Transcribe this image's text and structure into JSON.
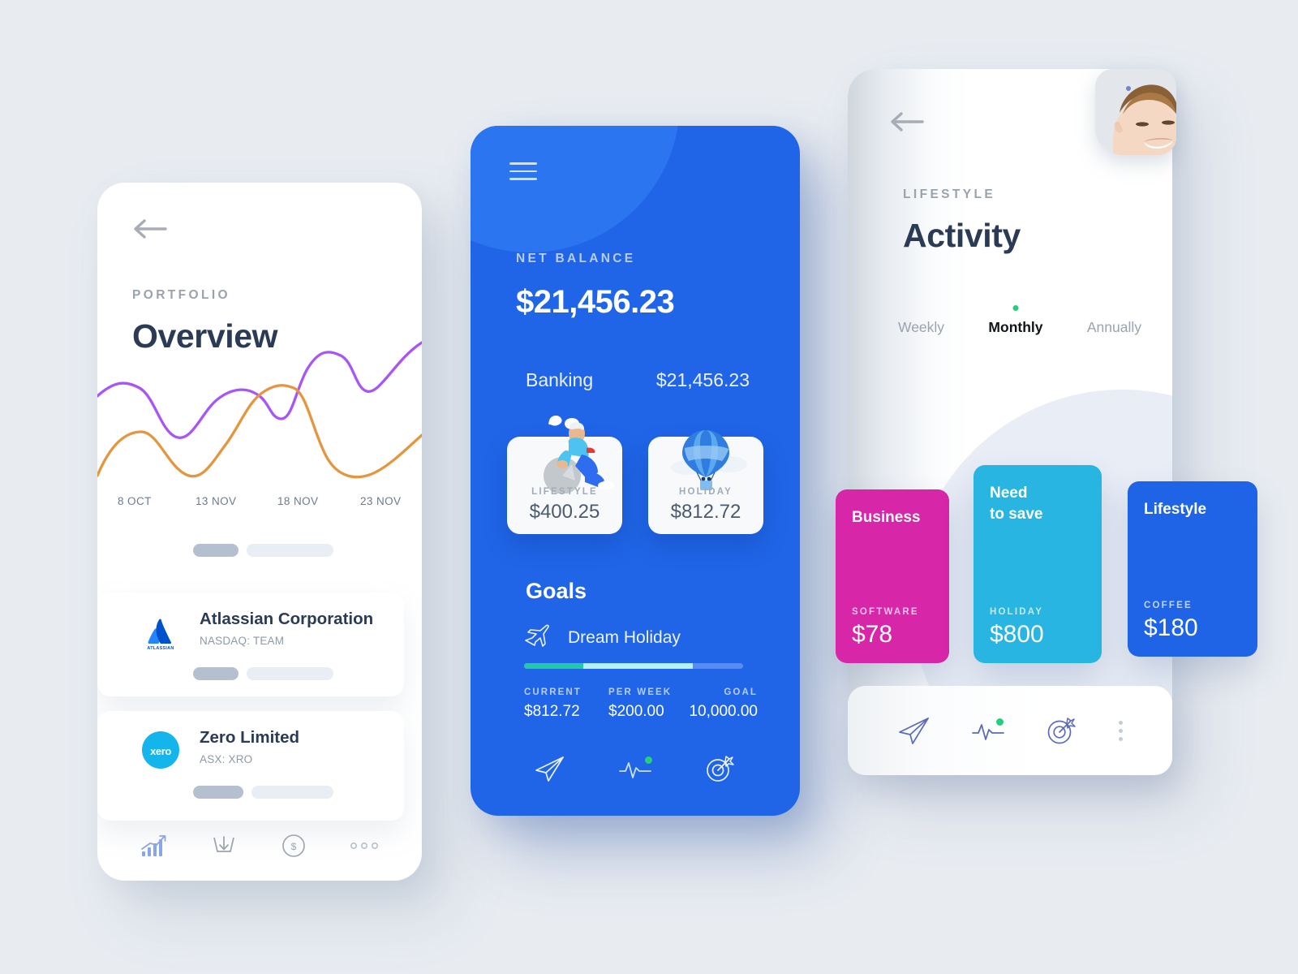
{
  "canvas": {
    "background": "#e8ecf1"
  },
  "phone1": {
    "back_icon": "back-arrow-icon",
    "eyebrow": "PORTFOLIO",
    "title": "Overview",
    "chart": {
      "axis_labels": [
        "8 OCT",
        "13 NOV",
        "18 NOV",
        "23 NOV"
      ],
      "series_colors": [
        "#a855f7",
        "#e4963f"
      ]
    },
    "stocks": [
      {
        "name": "Atlassian Corporation",
        "ticker": "NASDAQ: TEAM",
        "logo": "atlassian-logo"
      },
      {
        "name": "Zero Limited",
        "ticker": "ASX: XRO",
        "logo": "xero-logo"
      }
    ],
    "nav": [
      {
        "icon": "growth-chart-icon",
        "active": true
      },
      {
        "icon": "deposit-icon",
        "active": false
      },
      {
        "icon": "dollar-circle-icon",
        "active": false
      },
      {
        "icon": "more-horizontal-icon",
        "active": false
      }
    ]
  },
  "phone2": {
    "menu_icon": "hamburger-menu-icon",
    "net_balance_label": "NET BALANCE",
    "net_balance_amount": "$21,456.23",
    "account_name": "Banking",
    "account_amount": "$21,456.23",
    "cards": [
      {
        "caption": "LIFESTYLE",
        "value": "$400.25",
        "illustration": "person-on-ball-illustration"
      },
      {
        "caption": "HOLIDAY",
        "value": "$812.72",
        "illustration": "hot-air-balloon-illustration"
      }
    ],
    "goals_heading": "Goals",
    "goal": {
      "icon": "paper-plane-travel-icon",
      "name": "Dream Holiday",
      "progress_segment_a_pct": 27,
      "progress_segment_b_pct": 50,
      "columns": [
        {
          "label": "CURRENT",
          "value": "$812.72"
        },
        {
          "label": "PER WEEK",
          "value": "$200.00"
        },
        {
          "label": "GOAL",
          "value": "10,000.00"
        }
      ]
    },
    "nav": [
      {
        "icon": "send-icon",
        "badge": false
      },
      {
        "icon": "pulse-activity-icon",
        "badge": true
      },
      {
        "icon": "target-goal-icon",
        "badge": false
      }
    ]
  },
  "phone3": {
    "back_icon": "back-arrow-icon",
    "avatar": "user-avatar",
    "eyebrow": "LIFESTYLE",
    "title": "Activity",
    "tabs": [
      {
        "label": "Weekly",
        "active": false
      },
      {
        "label": "Monthly",
        "active": true
      },
      {
        "label": "Annually",
        "active": false
      }
    ],
    "bars": [
      {
        "title": "Business",
        "caption": "SOFTWARE",
        "value": "$78",
        "color": "#d726a8"
      },
      {
        "title": "Need\nto save",
        "caption": "HOLIDAY",
        "value": "$800",
        "color": "#28b5e1"
      },
      {
        "title": "Lifestyle",
        "caption": "COFFEE",
        "value": "$180",
        "color": "#1f63e6"
      }
    ],
    "nav": [
      {
        "icon": "send-icon",
        "badge": false
      },
      {
        "icon": "pulse-activity-icon",
        "badge": true
      },
      {
        "icon": "target-goal-icon",
        "badge": false
      },
      {
        "icon": "more-vertical-icon",
        "badge": false
      }
    ]
  }
}
